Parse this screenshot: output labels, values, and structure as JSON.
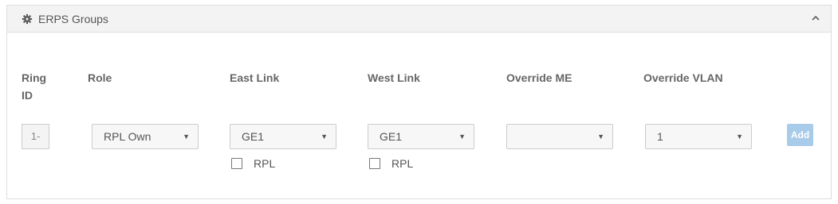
{
  "panel": {
    "title": "ERPS Groups",
    "icon": "gear-icon",
    "collapse_icon": "chevron-up-icon"
  },
  "columns": {
    "ring_id_line1": "Ring",
    "ring_id_line2": "ID",
    "role": "Role",
    "east_link": "East Link",
    "west_link": "West Link",
    "override_me": "Override ME",
    "override_vlan": "Override VLAN"
  },
  "form": {
    "ring_id_value": "1-",
    "role_value": "RPL Own",
    "east_link_value": "GE1",
    "east_rpl_label": "RPL",
    "west_link_value": "GE1",
    "west_rpl_label": "RPL",
    "override_me_value": "",
    "override_vlan_value": "1",
    "add_label": "Add"
  },
  "colors": {
    "add_button": "#a8cbea",
    "header_bg": "#f3f3f3"
  }
}
